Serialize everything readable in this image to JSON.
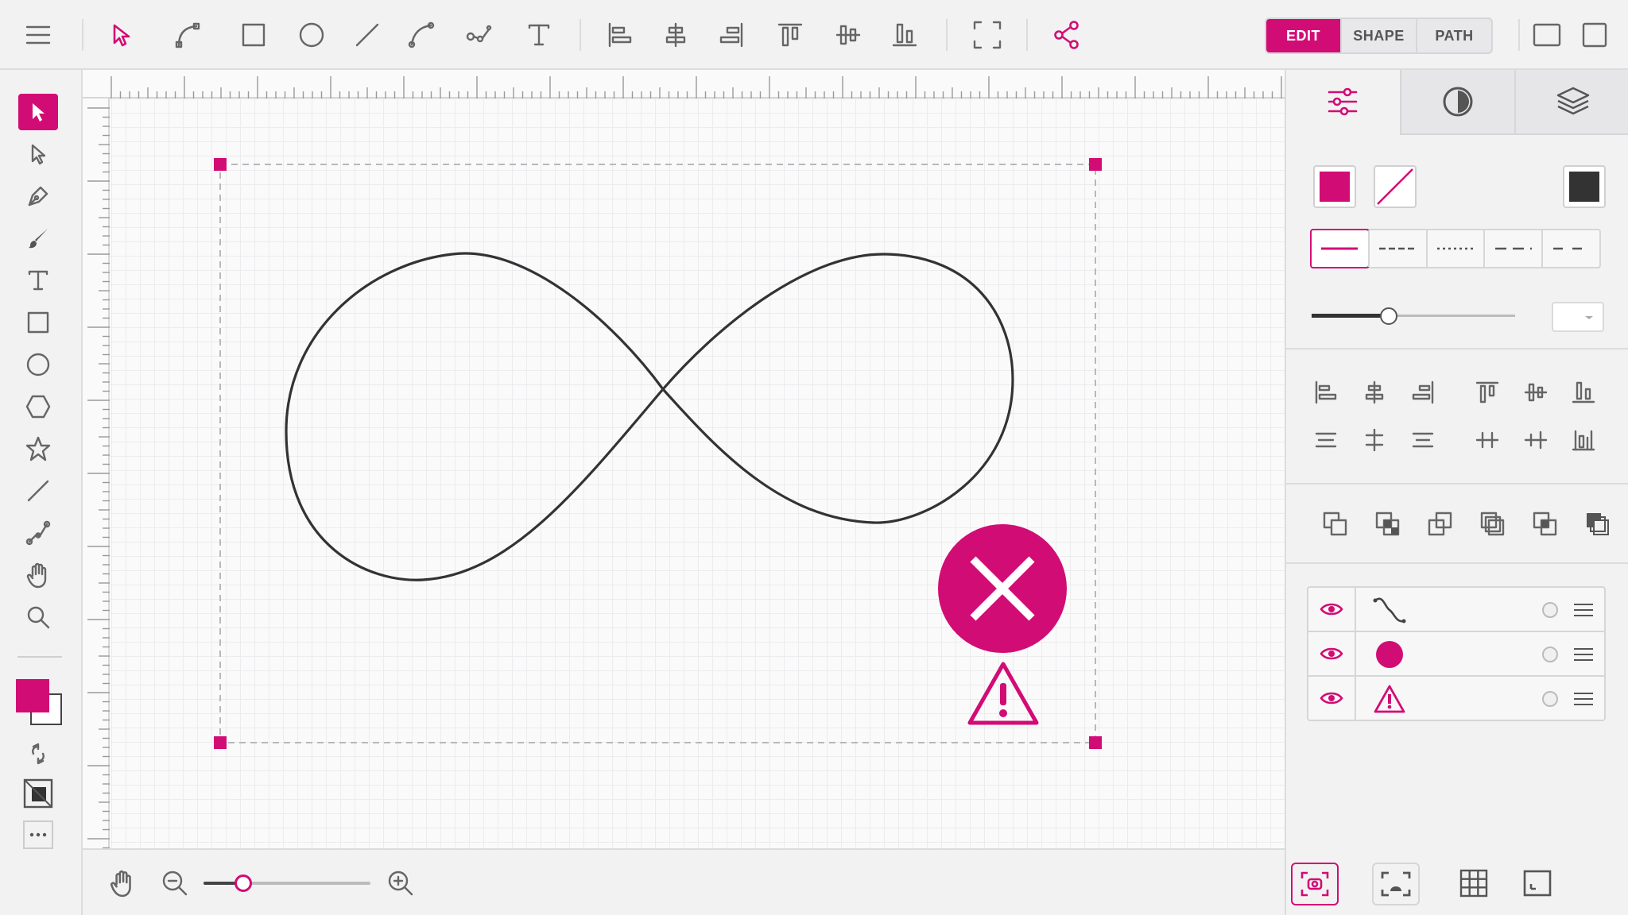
{
  "colors": {
    "accent": "#d20c75",
    "icon": "#666666",
    "stroke": "#333333"
  },
  "toolbar": {
    "icons": [
      "menu-icon",
      "select-arrow-icon",
      "node-edit-icon",
      "rectangle-icon",
      "ellipse-icon",
      "line-icon",
      "bezier-icon",
      "node-path-icon",
      "text-icon",
      "align-left-icon",
      "align-center-icon",
      "align-right-icon",
      "align-top-icon",
      "align-middle-icon",
      "align-bottom-icon",
      "fit-frame-icon",
      "share-icon"
    ],
    "modes": [
      {
        "label": "EDIT",
        "active": true
      },
      {
        "label": "SHAPE",
        "active": false
      },
      {
        "label": "PATH",
        "active": false
      }
    ],
    "window_icons": [
      "window-single-icon",
      "window-split-icon"
    ]
  },
  "left_tools": {
    "items": [
      "select-tool",
      "direct-select-tool",
      "pen-tool",
      "brush-tool",
      "text-tool",
      "rectangle-tool",
      "ellipse-tool",
      "polygon-tool",
      "star-tool",
      "line-tool",
      "path-tool",
      "hand-tool",
      "zoom-tool"
    ],
    "active": "select-tool",
    "fill_color": "#d20c75",
    "stroke_color": "#ffffff"
  },
  "canvas": {
    "shape": "infinity-curve",
    "stroke_color": "#333333",
    "delete_badge": "close-icon",
    "warning_badge": "warning-icon"
  },
  "right_panel": {
    "tabs": [
      {
        "icon": "sliders-icon",
        "active": true
      },
      {
        "icon": "contrast-icon",
        "active": false
      },
      {
        "icon": "layers-icon",
        "active": false
      }
    ],
    "fill_color": "#d20c75",
    "stroke_color": "none",
    "shadow_color": "#333333",
    "dash_styles": [
      "solid",
      "dashed",
      "dotted",
      "long-dash",
      "wide-dash"
    ],
    "stroke_width_fraction": 0.38,
    "layers": [
      {
        "name": "curve-layer",
        "visible": true
      },
      {
        "name": "circle-layer",
        "visible": true
      },
      {
        "name": "warning-layer",
        "visible": true
      }
    ]
  },
  "bottom_bar": {
    "zoom_fraction": 0.24,
    "tools": [
      "hand-icon",
      "zoom-out-icon",
      "zoom-in-icon",
      "screenshot-icon",
      "focus-frame-icon",
      "grid-icon",
      "corner-icon"
    ]
  }
}
